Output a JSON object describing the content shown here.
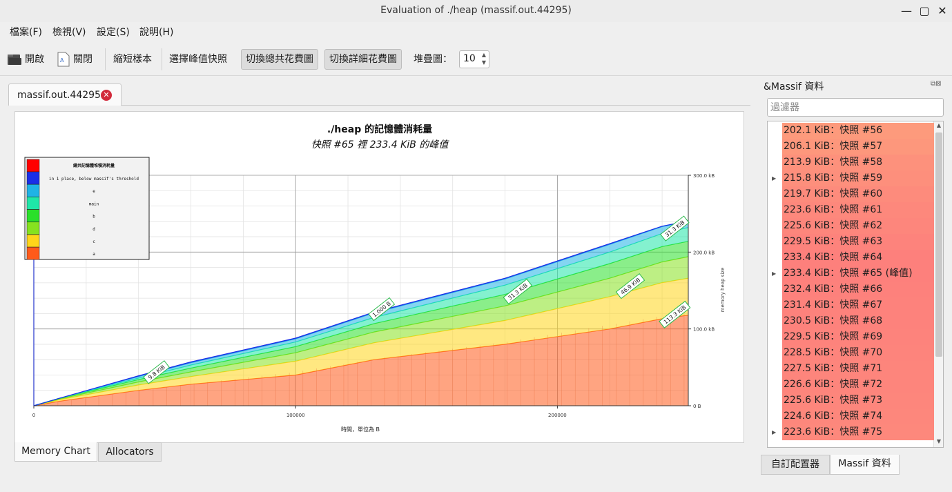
{
  "window": {
    "title": "Evaluation of ./heap (massif.out.44295)"
  },
  "menu": [
    "檔案(F)",
    "檢視(V)",
    "設定(S)",
    "說明(H)"
  ],
  "toolbar": {
    "open": "開啟",
    "close": "關閉",
    "shorten": "縮短樣本",
    "select_peak": "選擇峰值快照",
    "toggle_total": "切換總共花費圖",
    "toggle_detail": "切換詳細花費圖",
    "stack_label": "堆疊圖：",
    "stack_value": "10"
  },
  "document_tab": {
    "label": "massif.out.44295"
  },
  "chart_data": {
    "type": "area",
    "title": "./heap 的記憶體消耗量",
    "subtitle": "快照 #65 裡 233.4 KiB 的峰值",
    "xlabel": "時間，單位為 B",
    "ylabel": "memory heap size",
    "xlim": [
      0,
      250000
    ],
    "ylim": [
      0,
      300
    ],
    "x_ticks": [
      0,
      100000,
      200000
    ],
    "x_tick_labels": [
      "0",
      "100000",
      "200000"
    ],
    "y_ticks": [
      0,
      100,
      200,
      300
    ],
    "y_tick_labels": [
      "0 B",
      "100.0 kB",
      "200.0 kB",
      "300.0 kB"
    ],
    "grid": true,
    "legend_title": "總共記憶體堆積消耗量",
    "legend": [
      {
        "name": "in 1 place, below massif's threshold",
        "color": "#1a2ee8"
      },
      {
        "name": "e",
        "color": "#1fb3e6"
      },
      {
        "name": "main",
        "color": "#1fe6a8"
      },
      {
        "name": "b",
        "color": "#2ae02a"
      },
      {
        "name": "d",
        "color": "#86e21f"
      },
      {
        "name": "c",
        "color": "#ffd51a"
      },
      {
        "name": "a",
        "color": "#ff5a1a"
      }
    ],
    "x": [
      0,
      10000,
      40000,
      60000,
      100000,
      130000,
      180000,
      220000,
      240000,
      250000
    ],
    "series": [
      {
        "name": "a",
        "values": [
          0,
          6,
          20,
          28,
          40,
          60,
          80,
          100,
          113.3,
          118
        ]
      },
      {
        "name": "c",
        "values": [
          0,
          2,
          7,
          10,
          18,
          22,
          31,
          42,
          46.9,
          48
        ]
      },
      {
        "name": "d",
        "values": [
          0,
          1,
          4,
          6,
          11,
          14,
          19,
          24,
          27,
          28
        ]
      },
      {
        "name": "b",
        "values": [
          0,
          1,
          3,
          5,
          8,
          11,
          15,
          19,
          20,
          20
        ]
      },
      {
        "name": "main",
        "values": [
          0,
          0,
          2,
          4,
          6,
          8,
          12,
          15,
          17,
          18
        ]
      },
      {
        "name": "e",
        "values": [
          0,
          0,
          2,
          3,
          4,
          6,
          8,
          10,
          9,
          8
        ]
      },
      {
        "name": "in 1 place, below massif's threshold",
        "values": [
          0,
          0,
          1,
          1,
          1,
          1,
          1,
          1,
          0.5,
          0.5
        ]
      }
    ],
    "annotations": [
      {
        "text": "9.8 KiB",
        "x": 47000,
        "y": 43
      },
      {
        "text": "1,000 B",
        "x": 133000,
        "y": 125
      },
      {
        "text": "31.3 KiB",
        "x": 185000,
        "y": 148
      },
      {
        "text": "46.9 KiB",
        "x": 228000,
        "y": 155
      },
      {
        "text": "113.3 KiB",
        "x": 245000,
        "y": 118
      },
      {
        "text": "31.3 KiB",
        "x": 245000,
        "y": 230
      }
    ]
  },
  "bottom_tabs": [
    "Memory Chart",
    "Allocators"
  ],
  "dock": {
    "title": "&Massif 資料",
    "filter_placeholder": "過濾器",
    "snapshots": [
      {
        "label": "202.1 KiB：快照 #56",
        "expand": false,
        "color": "#fd9a7c"
      },
      {
        "label": "206.1 KiB：快照 #57",
        "expand": false,
        "color": "#fd977c"
      },
      {
        "label": "213.9 KiB：快照 #58",
        "expand": false,
        "color": "#fd917c"
      },
      {
        "label": "215.8 KiB：快照 #59",
        "expand": true,
        "color": "#fd8f7c"
      },
      {
        "label": "219.7 KiB：快照 #60",
        "expand": false,
        "color": "#fd8b7c"
      },
      {
        "label": "223.6 KiB：快照 #61",
        "expand": false,
        "color": "#fd887c"
      },
      {
        "label": "225.6 KiB：快照 #62",
        "expand": false,
        "color": "#fd867c"
      },
      {
        "label": "229.5 KiB：快照 #63",
        "expand": false,
        "color": "#fd837c"
      },
      {
        "label": "233.4 KiB：快照 #64",
        "expand": false,
        "color": "#fd807c"
      },
      {
        "label": "233.4 KiB：快照 #65 (峰值)",
        "expand": true,
        "color": "#fd807c"
      },
      {
        "label": "232.4 KiB：快照 #66",
        "expand": false,
        "color": "#fd817c"
      },
      {
        "label": "231.4 KiB：快照 #67",
        "expand": false,
        "color": "#fd827c"
      },
      {
        "label": "230.5 KiB：快照 #68",
        "expand": false,
        "color": "#fd827c"
      },
      {
        "label": "229.5 KiB：快照 #69",
        "expand": false,
        "color": "#fd837c"
      },
      {
        "label": "228.5 KiB：快照 #70",
        "expand": false,
        "color": "#fd847c"
      },
      {
        "label": "227.5 KiB：快照 #71",
        "expand": false,
        "color": "#fd857c"
      },
      {
        "label": "226.6 KiB：快照 #72",
        "expand": false,
        "color": "#fd857c"
      },
      {
        "label": "225.6 KiB：快照 #73",
        "expand": false,
        "color": "#fd867c"
      },
      {
        "label": "224.6 KiB：快照 #74",
        "expand": false,
        "color": "#fd877c"
      },
      {
        "label": "223.6 KiB：快照 #75",
        "expand": true,
        "color": "#fd887c"
      }
    ],
    "tabs": [
      "自訂配置器",
      "Massif 資料"
    ]
  }
}
